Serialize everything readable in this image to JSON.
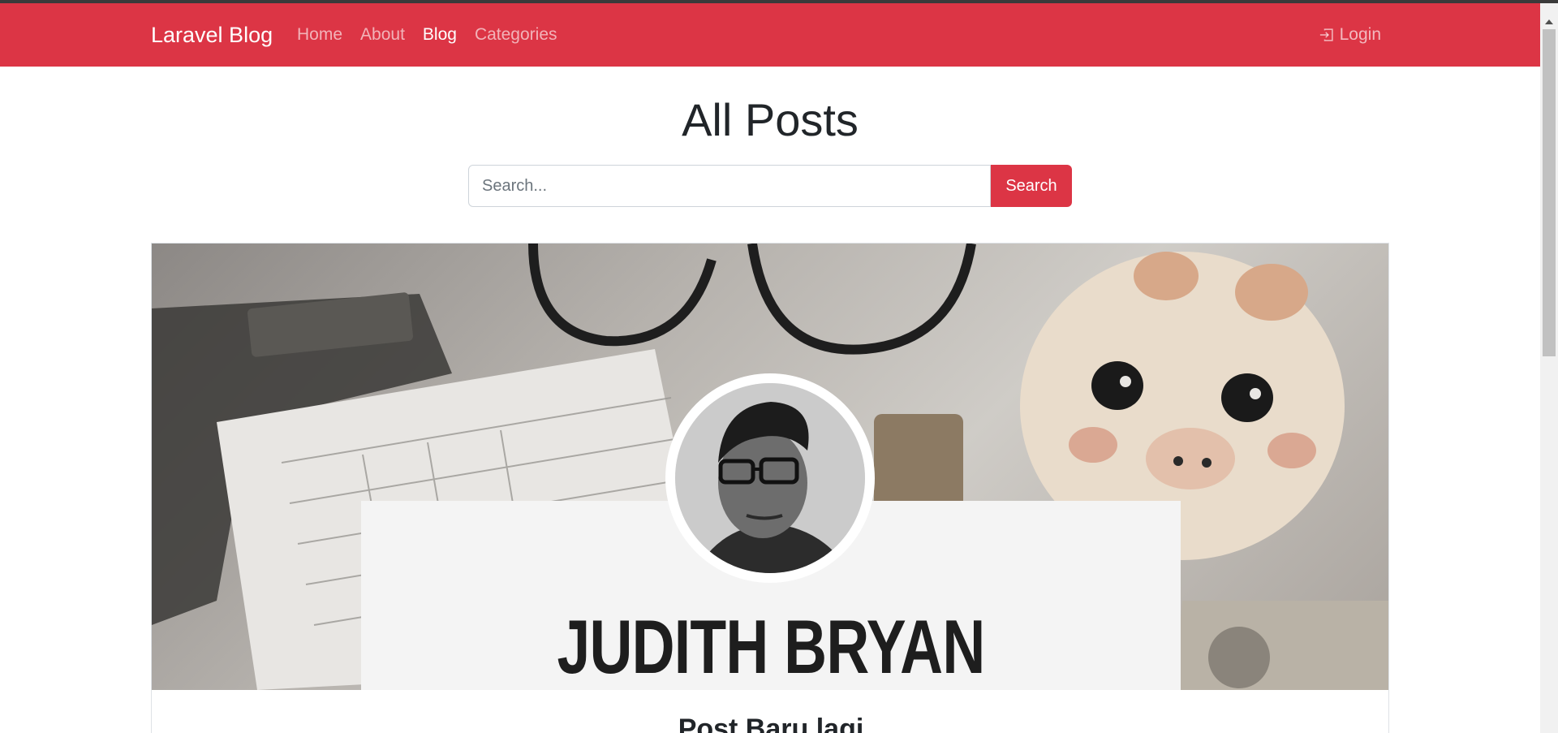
{
  "navbar": {
    "brand": "Laravel Blog",
    "links": [
      {
        "label": "Home",
        "active": false
      },
      {
        "label": "About",
        "active": false
      },
      {
        "label": "Blog",
        "active": true
      },
      {
        "label": "Categories",
        "active": false
      }
    ],
    "login_label": "Login",
    "login_icon": "box-arrow-in-right-icon"
  },
  "page": {
    "title": "All Posts"
  },
  "search": {
    "placeholder": "Search...",
    "button_label": "Search"
  },
  "hero": {
    "name": "JUDITH BRYAN LEONARD SIE",
    "avatar_icon": "author-avatar"
  },
  "post": {
    "title": "Post Baru lagi"
  },
  "colors": {
    "brand": "#dc3545",
    "text": "#212529"
  }
}
